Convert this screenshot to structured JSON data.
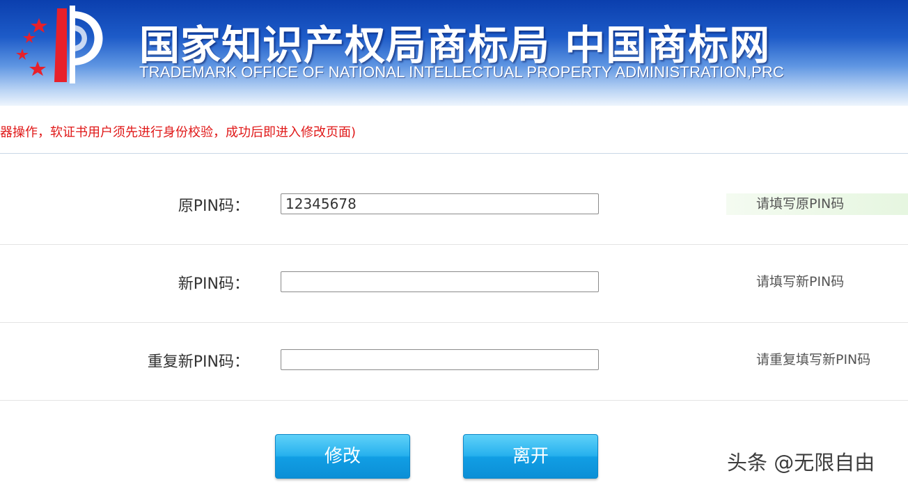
{
  "header": {
    "title_cn": "国家知识产权局商标局 中国商标网",
    "title_en": "TRADEMARK OFFICE OF NATIONAL INTELLECTUAL PROPERTY ADMINISTRATION,PRC"
  },
  "notice": "器操作，软证书用户须先进行身份校验，成功后即进入修改页面)",
  "form": {
    "original_pin": {
      "label": "原PIN码：",
      "value": "12345678",
      "hint": "请填写原PIN码"
    },
    "new_pin": {
      "label": "新PIN码：",
      "value": "",
      "hint": "请填写新PIN码"
    },
    "repeat_pin": {
      "label": "重复新PIN码：",
      "value": "",
      "hint": "请重复填写新PIN码"
    }
  },
  "buttons": {
    "modify": "修改",
    "leave": "离开"
  },
  "watermark": "头条 @无限自由",
  "colors": {
    "header_blue": "#0b3fae",
    "notice_red": "#e01818",
    "button_blue": "#1aa6ea",
    "hint_green": "#e6f6e0"
  }
}
